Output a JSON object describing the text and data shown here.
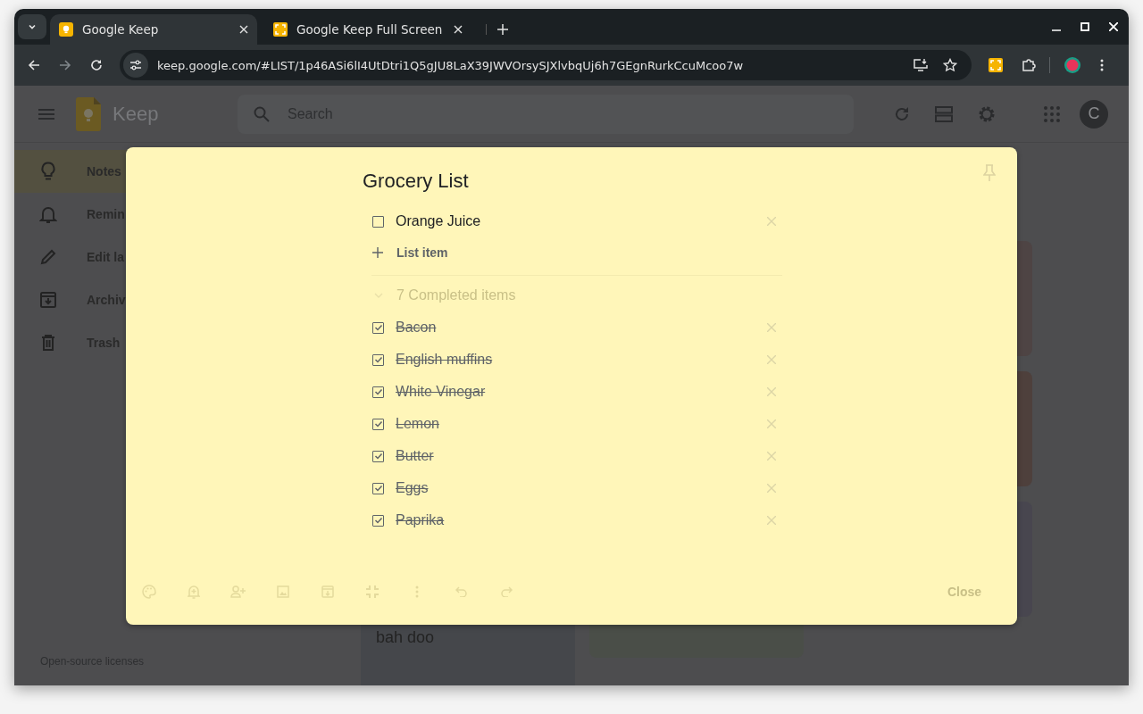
{
  "browser": {
    "tabs": [
      {
        "title": "Google Keep",
        "selected": true,
        "kind": "keep"
      },
      {
        "title": "Google Keep Full Screen",
        "selected": false,
        "kind": "extension"
      }
    ],
    "url": "keep.google.com/#LIST/1p46ASi6lI4UtDtri1Q5gJU8LaX39JWVOrsySJXlvbqUj6h7GEgnRurkCcuMcoo7w"
  },
  "keep": {
    "app_name": "Keep",
    "search": {
      "placeholder": "Search"
    },
    "account_initial": "C",
    "sidebar": {
      "items": [
        {
          "label": "Notes",
          "selected": true,
          "kind": "bulb"
        },
        {
          "label": "Remin",
          "selected": false,
          "kind": "bell"
        },
        {
          "label": "Edit la",
          "selected": false,
          "kind": "pencil"
        },
        {
          "label": "Archiv",
          "selected": false,
          "kind": "archive"
        },
        {
          "label": "Trash",
          "selected": false,
          "kind": "trash"
        }
      ]
    },
    "footer_link": "Open-source licenses",
    "notes": [
      {
        "text": "bah doo"
      }
    ]
  },
  "note_dialog": {
    "title": "Grocery List",
    "items": [
      {
        "text": "Orange Juice",
        "checked": false
      }
    ],
    "add_item_label": "List item",
    "completed_label": "7 Completed items",
    "completed_items": [
      {
        "text": "Bacon",
        "checked": true
      },
      {
        "text": "English muffins",
        "checked": true
      },
      {
        "text": "White Vinegar",
        "checked": true
      },
      {
        "text": "Lemon",
        "checked": true
      },
      {
        "text": "Butter",
        "checked": true
      },
      {
        "text": "Eggs",
        "checked": true
      },
      {
        "text": "Paprika",
        "checked": true
      }
    ],
    "close_label": "Close"
  }
}
